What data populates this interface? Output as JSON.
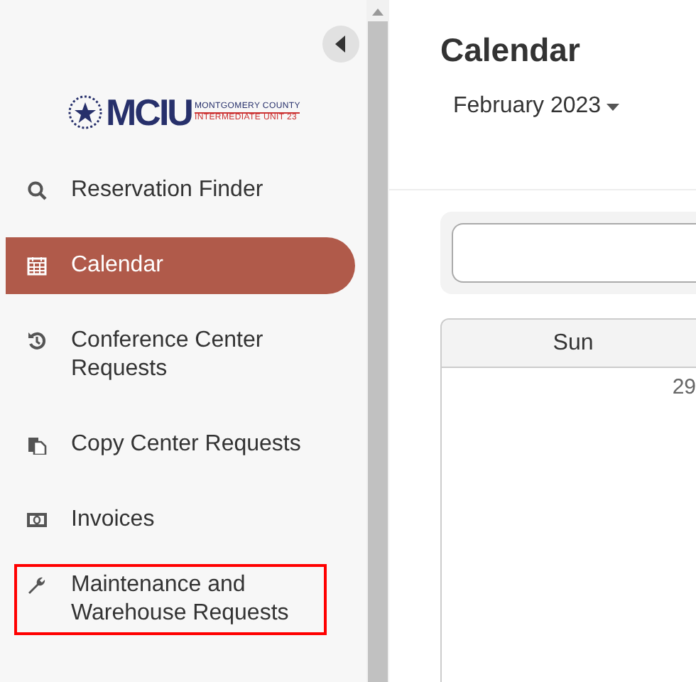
{
  "sidebar": {
    "logo": {
      "wordmark": "MCIU",
      "line_1": "MONTGOMERY COUNTY",
      "line_2": "INTERMEDIATE UNIT 23"
    },
    "items": [
      {
        "kind": "search",
        "label": "Reservation Finder",
        "selected": false,
        "highlighted": false
      },
      {
        "kind": "calendar",
        "label": "Calendar",
        "selected": true,
        "highlighted": false
      },
      {
        "kind": "history",
        "label": "Conference Center Requests",
        "selected": false,
        "highlighted": false
      },
      {
        "kind": "copy",
        "label": "Copy Center Requests",
        "selected": false,
        "highlighted": false
      },
      {
        "kind": "money",
        "label": "Invoices",
        "selected": false,
        "highlighted": false
      },
      {
        "kind": "wrench",
        "label": "Maintenance and Warehouse Requests",
        "selected": false,
        "highlighted": true
      }
    ]
  },
  "main": {
    "title": "Calendar",
    "month": "February 2023",
    "calendar": {
      "columns": [
        "Sun"
      ],
      "first_date": "29"
    }
  }
}
